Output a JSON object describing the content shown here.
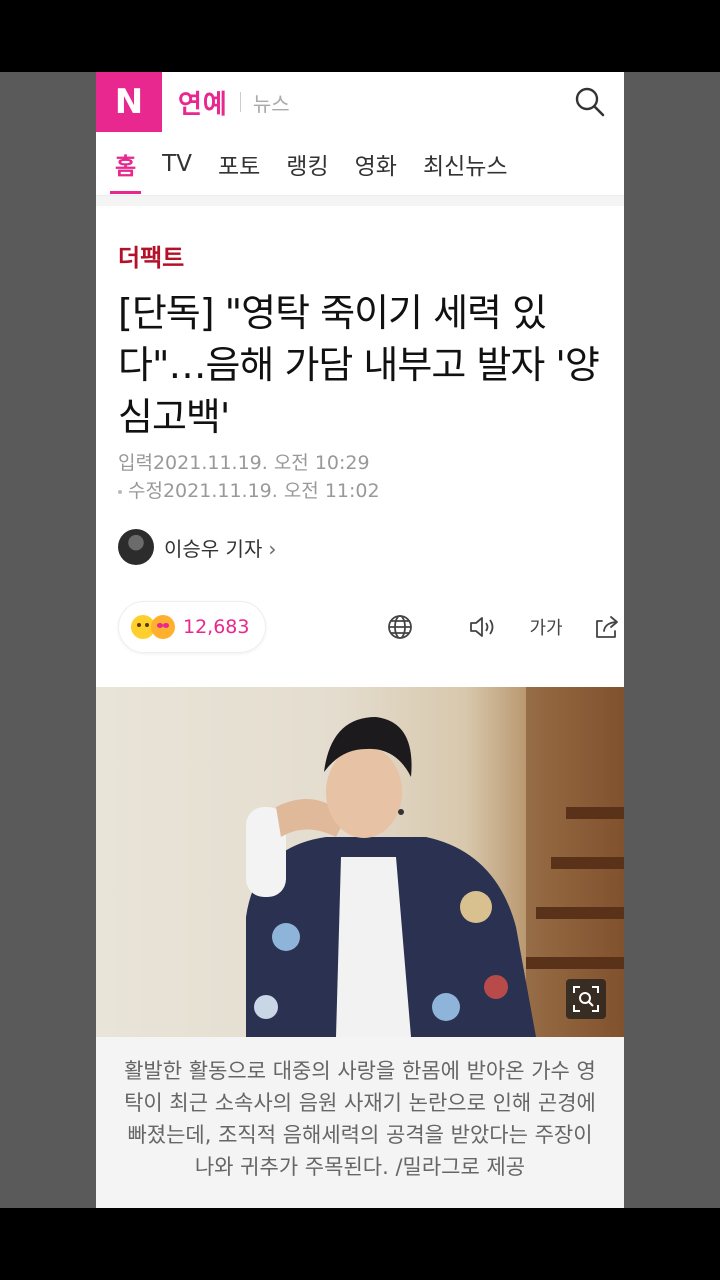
{
  "header": {
    "logo": "N",
    "brand": "연예",
    "sub": "뉴스",
    "search_icon": "search-icon"
  },
  "tabs": [
    {
      "label": "홈",
      "active": true
    },
    {
      "label": "TV"
    },
    {
      "label": "포토"
    },
    {
      "label": "랭킹"
    },
    {
      "label": "영화"
    },
    {
      "label": "최신뉴스"
    }
  ],
  "article": {
    "source": "더팩트",
    "title": "[단독] \"영탁 죽이기 세력 있다\"…음해 가담 내부고 발자 '양심고백'",
    "published": "입력2021.11.19. 오전 10:29",
    "modified": "수정2021.11.19. 오전 11:02",
    "author": "이승우 기자",
    "reaction_count": "12,683",
    "tools": [
      "globe-icon",
      "speaker-icon",
      "font-size-icon",
      "share-icon"
    ],
    "font_size_label": "가가",
    "caption": "활발한 활동으로 대중의 사랑을 한몸에 받아온 가수 영탁이 최근 소속사의 음원 사재기 논란으로 인해 곤경에 빠졌는데, 조직적 음해세력의 공격을 받았다는 주장이 나와 귀추가 주목된다. /밀라그로 제공"
  },
  "colors": {
    "accent": "#e8278f",
    "source_red": "#b3102a"
  }
}
